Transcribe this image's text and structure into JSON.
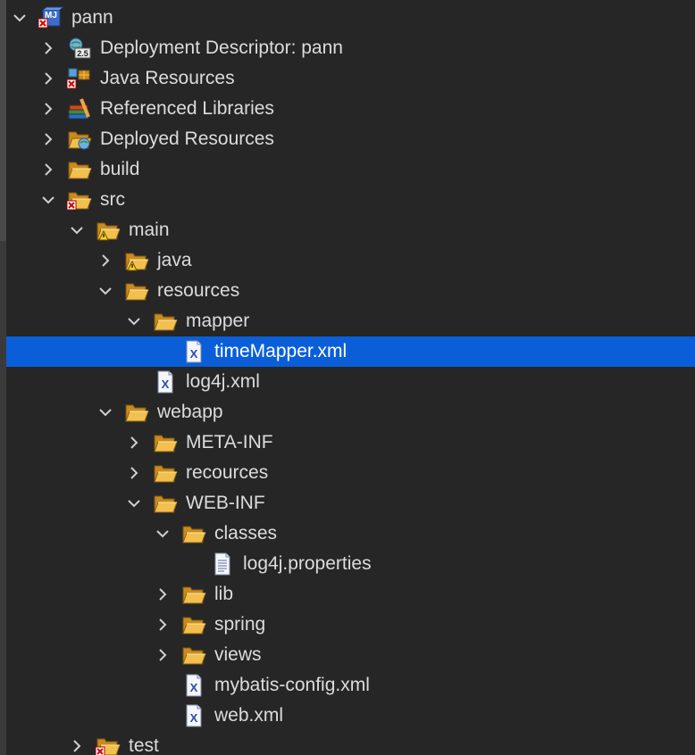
{
  "colors": {
    "background": "#262626",
    "selection": "#0a5fd9",
    "text": "#dcdcdc",
    "folder": "#e8a93c"
  },
  "tree": {
    "items": [
      {
        "label": "pann",
        "depth": 0,
        "expand": "open",
        "icon": "maven-project-icon"
      },
      {
        "label": "Deployment Descriptor: pann",
        "depth": 1,
        "expand": "closed",
        "icon": "deployment-descriptor-icon"
      },
      {
        "label": "Java Resources",
        "depth": 1,
        "expand": "closed",
        "icon": "java-resources-icon"
      },
      {
        "label": "Referenced Libraries",
        "depth": 1,
        "expand": "closed",
        "icon": "library-icon"
      },
      {
        "label": "Deployed Resources",
        "depth": 1,
        "expand": "closed",
        "icon": "deployed-resources-icon"
      },
      {
        "label": "build",
        "depth": 1,
        "expand": "closed",
        "icon": "folder-icon"
      },
      {
        "label": "src",
        "depth": 1,
        "expand": "open",
        "icon": "folder-error-icon"
      },
      {
        "label": "main",
        "depth": 2,
        "expand": "open",
        "icon": "folder-warning-icon"
      },
      {
        "label": "java",
        "depth": 3,
        "expand": "closed",
        "icon": "folder-warning-icon"
      },
      {
        "label": "resources",
        "depth": 3,
        "expand": "open",
        "icon": "folder-icon"
      },
      {
        "label": "mapper",
        "depth": 4,
        "expand": "open",
        "icon": "folder-icon"
      },
      {
        "label": "timeMapper.xml",
        "depth": 5,
        "expand": "none",
        "icon": "xml-file-icon",
        "selected": true
      },
      {
        "label": "log4j.xml",
        "depth": 4,
        "expand": "none",
        "icon": "xml-file-icon"
      },
      {
        "label": "webapp",
        "depth": 3,
        "expand": "open",
        "icon": "folder-icon"
      },
      {
        "label": "META-INF",
        "depth": 4,
        "expand": "closed",
        "icon": "folder-icon"
      },
      {
        "label": "recources",
        "depth": 4,
        "expand": "closed",
        "icon": "folder-icon"
      },
      {
        "label": "WEB-INF",
        "depth": 4,
        "expand": "open",
        "icon": "folder-icon"
      },
      {
        "label": "classes",
        "depth": 5,
        "expand": "open",
        "icon": "folder-icon"
      },
      {
        "label": "log4j.properties",
        "depth": 6,
        "expand": "none",
        "icon": "text-file-icon"
      },
      {
        "label": "lib",
        "depth": 5,
        "expand": "closed",
        "icon": "folder-icon"
      },
      {
        "label": "spring",
        "depth": 5,
        "expand": "closed",
        "icon": "folder-icon"
      },
      {
        "label": "views",
        "depth": 5,
        "expand": "closed",
        "icon": "folder-icon"
      },
      {
        "label": "mybatis-config.xml",
        "depth": 5,
        "expand": "none",
        "icon": "xml-file-icon"
      },
      {
        "label": "web.xml",
        "depth": 5,
        "expand": "none",
        "icon": "xml-file-icon"
      },
      {
        "label": "test",
        "depth": 2,
        "expand": "closed",
        "icon": "folder-error-icon"
      }
    ]
  }
}
